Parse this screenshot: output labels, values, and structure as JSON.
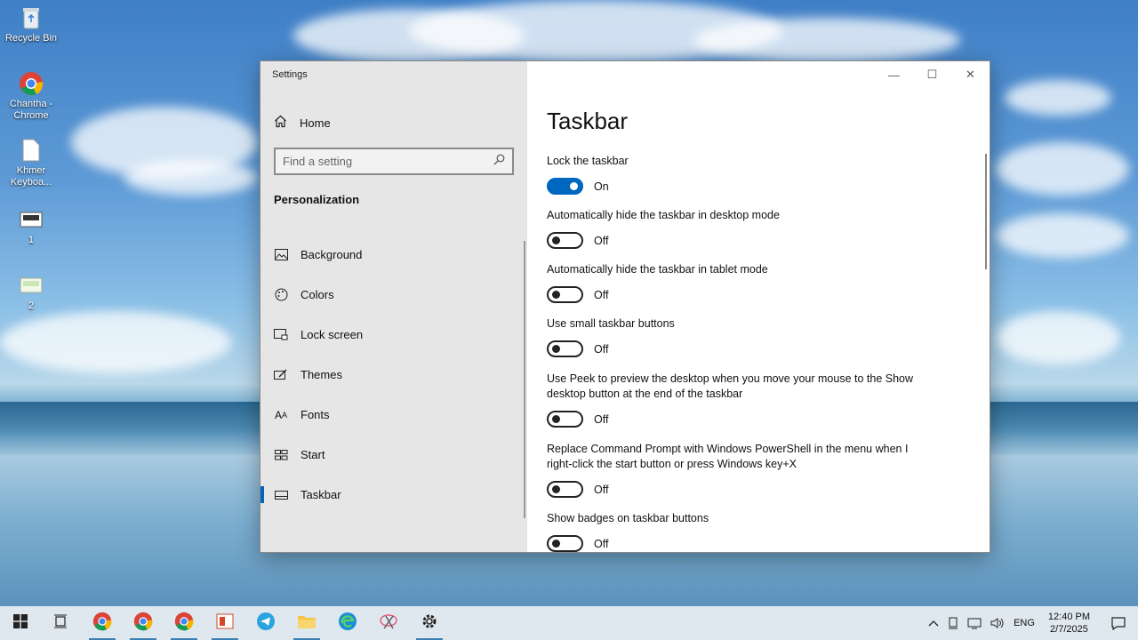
{
  "desktop": {
    "icons": [
      {
        "label": "Recycle Bin"
      },
      {
        "label": "Chantha - Chrome"
      },
      {
        "label": "Khmer Keyboa..."
      },
      {
        "label": "1"
      },
      {
        "label": "2"
      }
    ]
  },
  "window": {
    "title": "Settings",
    "controls": {
      "minimize": "—",
      "maximize": "☐",
      "close": "✕"
    }
  },
  "sidebar": {
    "home_label": "Home",
    "search_placeholder": "Find a setting",
    "section": "Personalization",
    "items": [
      {
        "label": "Background",
        "icon": "image-icon"
      },
      {
        "label": "Colors",
        "icon": "palette-icon"
      },
      {
        "label": "Lock screen",
        "icon": "lock-screen-icon"
      },
      {
        "label": "Themes",
        "icon": "brush-icon"
      },
      {
        "label": "Fonts",
        "icon": "font-icon"
      },
      {
        "label": "Start",
        "icon": "start-icon"
      },
      {
        "label": "Taskbar",
        "icon": "taskbar-icon",
        "active": true
      }
    ]
  },
  "main": {
    "title": "Taskbar",
    "settings": [
      {
        "label": "Lock the taskbar",
        "state": "On",
        "on": true
      },
      {
        "label": "Automatically hide the taskbar in desktop mode",
        "state": "Off",
        "on": false
      },
      {
        "label": "Automatically hide the taskbar in tablet mode",
        "state": "Off",
        "on": false
      },
      {
        "label": "Use small taskbar buttons",
        "state": "Off",
        "on": false
      },
      {
        "label": "Use Peek to preview the desktop when you move your mouse to the Show desktop button at the end of the taskbar",
        "state": "Off",
        "on": false
      },
      {
        "label": "Replace Command Prompt with Windows PowerShell in the menu when I right-click the start button or press Windows key+X",
        "state": "Off",
        "on": false
      },
      {
        "label": "Show badges on taskbar buttons",
        "state": "Off",
        "on": false
      }
    ]
  },
  "taskbar": {
    "apps": [
      "start-icon",
      "task-view-icon",
      "chrome-icon",
      "chrome-icon",
      "chrome-icon",
      "powerpoint-icon",
      "telegram-icon",
      "file-explorer-icon",
      "edge-icon",
      "snipping-tool-icon",
      "settings-icon"
    ],
    "tray": {
      "language": "ENG",
      "time": "12:40 PM",
      "date": "2/7/2025"
    }
  },
  "colors": {
    "accent": "#0067c0",
    "taskbar": "#dfe8ee",
    "sidebar": "#e6e6e6"
  }
}
